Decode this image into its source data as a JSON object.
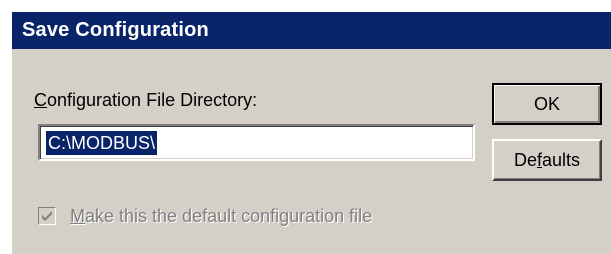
{
  "window": {
    "title": "Save Configuration"
  },
  "directory": {
    "label_mnemonic": "C",
    "label_rest": "onfiguration File Directory:",
    "value": "C:\\MODBUS\\"
  },
  "buttons": {
    "ok_label": "OK",
    "defaults_pre": "De",
    "defaults_mnemonic": "f",
    "defaults_post": "aults"
  },
  "default_checkbox": {
    "checked": true,
    "enabled": false,
    "label_mnemonic": "M",
    "label_rest": "ake this the default configuration file"
  },
  "colors": {
    "titlebar": "#0a246a",
    "dialog_bg": "#d4d0c8",
    "selection": "#0a246a",
    "disabled_text": "#808080"
  }
}
